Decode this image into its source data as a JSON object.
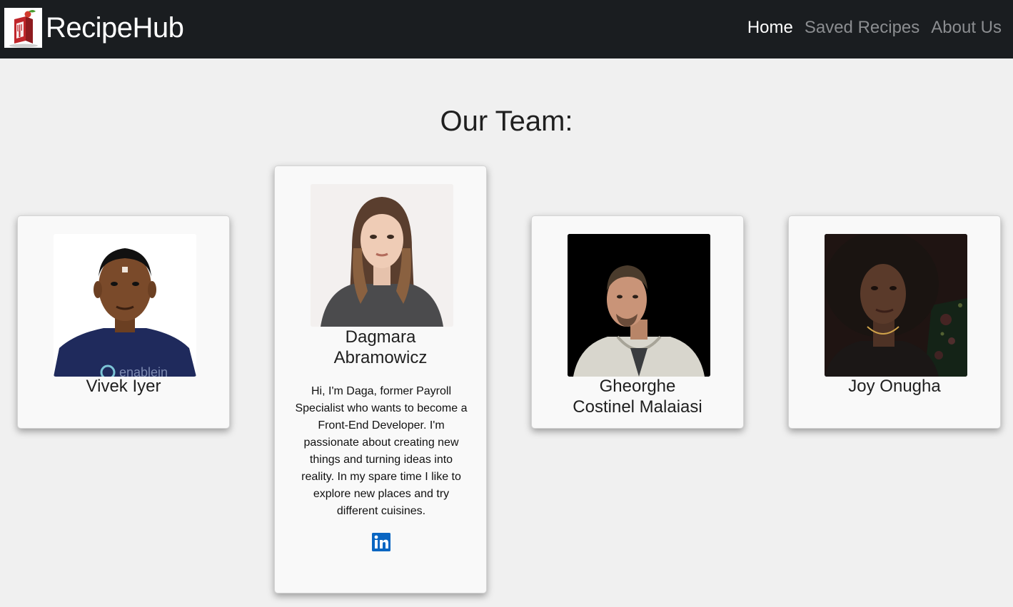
{
  "navbar": {
    "brand_title": "RecipeHub",
    "links": [
      "Home",
      "Saved Recipes",
      "About Us"
    ],
    "colors": {
      "background": "#1a1d20",
      "active": "#ffffff",
      "inactive": "#8b8d90"
    }
  },
  "page": {
    "heading": "Our Team:"
  },
  "team": [
    {
      "name_line1": "Vivek Iyer",
      "name_line2": ""
    },
    {
      "name_line1": "Dagmara",
      "name_line2": "Abramowicz",
      "bio": "Hi, I'm Daga, former Payroll Specialist who wants to become a Front-End Developer. I'm passionate about creating new things and turning ideas into reality. In my spare time I like to explore new places and try different cuisines.",
      "social_icon": "linkedin-icon"
    },
    {
      "name_line1": "Gheorghe",
      "name_line2": "Costinel Malaiasi"
    },
    {
      "name_line1": "Joy Onugha",
      "name_line2": ""
    }
  ],
  "photo_logo_text": "enablein"
}
